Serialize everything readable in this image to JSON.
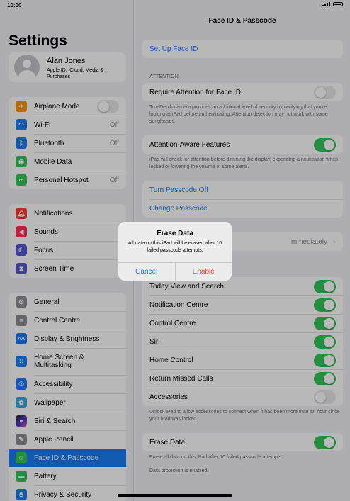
{
  "status": {
    "time": "10:00"
  },
  "sidebar": {
    "title": "Settings",
    "profile": {
      "name": "Alan Jones",
      "subtitle": "Apple ID, iCloud, Media & Purchases"
    },
    "group1": [
      {
        "label": "Airplane Mode",
        "icon": "airplane-icon",
        "color": "#ff9500",
        "toggle": false
      },
      {
        "label": "Wi-Fi",
        "icon": "wifi-icon",
        "color": "#1c7cf4",
        "value": "Off"
      },
      {
        "label": "Bluetooth",
        "icon": "bluetooth-icon",
        "color": "#1c7cf4",
        "value": "Off"
      },
      {
        "label": "Mobile Data",
        "icon": "antenna-icon",
        "color": "#34c759"
      },
      {
        "label": "Personal Hotspot",
        "icon": "hotspot-icon",
        "color": "#34c759",
        "value": "Off"
      }
    ],
    "group2": [
      {
        "label": "Notifications",
        "icon": "bell-icon",
        "color": "#ff3b30"
      },
      {
        "label": "Sounds",
        "icon": "speaker-icon",
        "color": "#ff2d55"
      },
      {
        "label": "Focus",
        "icon": "moon-icon",
        "color": "#5856d6"
      },
      {
        "label": "Screen Time",
        "icon": "hourglass-icon",
        "color": "#5856d6"
      }
    ],
    "group3": [
      {
        "label": "General",
        "icon": "gear-icon",
        "color": "#8e8e93"
      },
      {
        "label": "Control Centre",
        "icon": "sliders-icon",
        "color": "#8e8e93"
      },
      {
        "label": "Display & Brightness",
        "icon": "text-size-icon",
        "color": "#1c7cf4"
      },
      {
        "label": "Home Screen & Multitasking",
        "icon": "grid-icon",
        "color": "#1c7cf4"
      },
      {
        "label": "Accessibility",
        "icon": "accessibility-icon",
        "color": "#1c7cf4"
      },
      {
        "label": "Wallpaper",
        "icon": "flower-icon",
        "color": "#35aadc"
      },
      {
        "label": "Siri & Search",
        "icon": "siri-icon",
        "color": "#222222"
      },
      {
        "label": "Apple Pencil",
        "icon": "pencil-icon",
        "color": "#8e8e93"
      },
      {
        "label": "Face ID & Passcode",
        "icon": "face-id-icon",
        "color": "#34c759"
      },
      {
        "label": "Battery",
        "icon": "battery-icon",
        "color": "#34c759"
      },
      {
        "label": "Privacy & Security",
        "icon": "hand-icon",
        "color": "#1c7cf4"
      }
    ]
  },
  "detail": {
    "title": "Face ID & Passcode",
    "setup": "Set Up Face ID",
    "attention_header": "ATTENTION",
    "require_attention": "Require Attention for Face ID",
    "require_attention_note": "TrueDepth camera provides an additional level of security by verifying that you're looking at iPad before authenticating. Attention detection may not work with some sunglasses.",
    "attention_aware": "Attention-Aware Features",
    "attention_aware_note": "iPad will check for attention before dimming the display, expanding a notification when locked or lowering the volume of some alerts.",
    "turn_off": "Turn Passcode Off",
    "change": "Change Passcode",
    "require_value": "Immediately",
    "locked_items": [
      {
        "label": "Today View and Search",
        "on": true
      },
      {
        "label": "Notification Centre",
        "on": true
      },
      {
        "label": "Control Centre",
        "on": true
      },
      {
        "label": "Siri",
        "on": true
      },
      {
        "label": "Home Control",
        "on": true
      },
      {
        "label": "Return Missed Calls",
        "on": true
      },
      {
        "label": "Accessories",
        "on": false
      }
    ],
    "accessories_note": "Unlock iPad to allow accessories to connect when it has been more than an hour since your iPad was locked.",
    "erase_data": "Erase Data",
    "erase_note": "Erase all data on this iPad after 10 failed passcode attempts.",
    "protection_note": "Data protection is enabled."
  },
  "alert": {
    "title": "Erase Data",
    "message": "All data on this iPad will be erased after 10 failed passcode attempts.",
    "cancel": "Cancel",
    "confirm": "Enable"
  }
}
